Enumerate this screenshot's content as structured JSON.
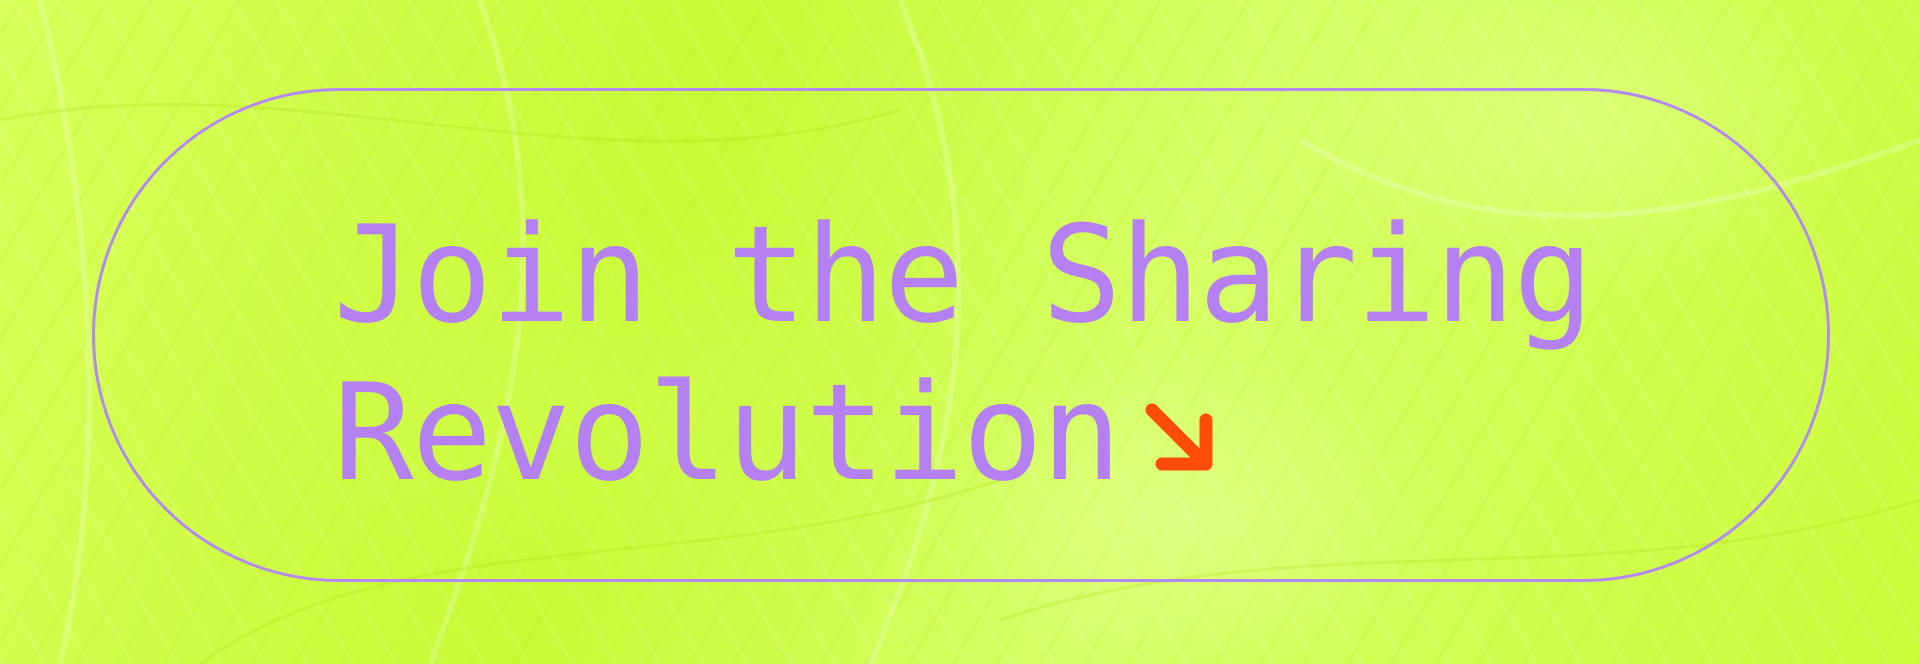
{
  "banner": {
    "headline_line1": "Join the Sharing",
    "headline_line2": "Revolution"
  },
  "icons": {
    "arrow": "arrow-down-right-icon"
  },
  "colors": {
    "background": "#cdfc3c",
    "text": "#b580f2",
    "outline": "#b58af0",
    "arrow": "#ff4c0a"
  }
}
